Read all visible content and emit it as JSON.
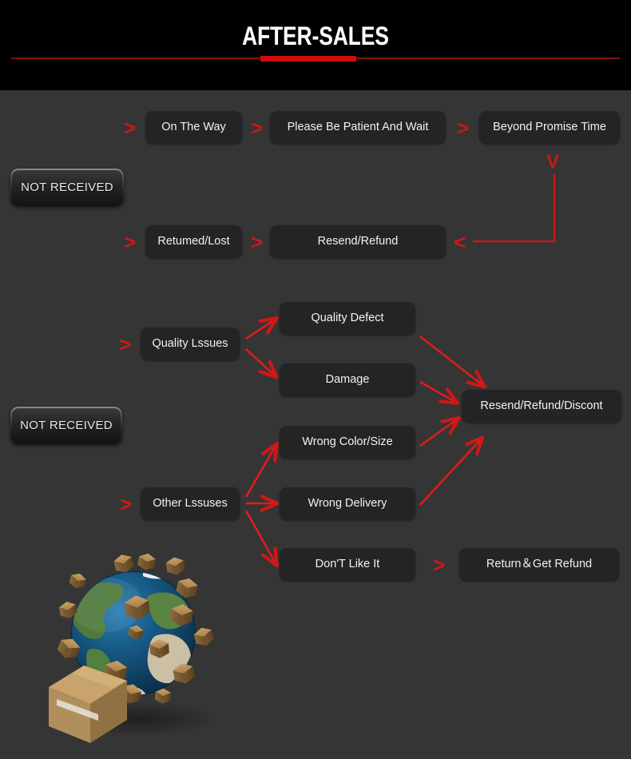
{
  "header": {
    "title": "AFTER-SALES",
    "rule_color": "#7e1414",
    "accent_color": "#cc0d0d"
  },
  "theme": {
    "background": "#353535",
    "header_background": "#000000",
    "box_background": "#242424",
    "box_text": "#f2f2f2",
    "arrow_color": "#cf1717"
  },
  "badges": [
    {
      "label": "NOT RECEIVED"
    },
    {
      "label": "NOT RECEIVED"
    }
  ],
  "flow": {
    "not_received_chain": {
      "row_top": [
        {
          "label": "On The Way"
        },
        {
          "label": "Please Be Patient And Wait"
        },
        {
          "label": "Beyond Promise Time"
        }
      ],
      "row_bottom": [
        {
          "label": "Retumed/Lost"
        },
        {
          "label": "Resend/Refund"
        }
      ]
    },
    "quality_issues": {
      "source": {
        "label": "Quality Lssues"
      },
      "branches": [
        {
          "label": "Quality Defect"
        },
        {
          "label": "Damage"
        }
      ]
    },
    "other_issues": {
      "source": {
        "label": "Other Lssuses"
      },
      "branches": [
        {
          "label": "Wrong Color/Size"
        },
        {
          "label": "Wrong Delivery"
        },
        {
          "label": "Don'T Like It"
        }
      ]
    },
    "outcomes": [
      {
        "label": "Resend/Refund/Discont"
      },
      {
        "label": "Return＆Get Refund"
      }
    ]
  },
  "icons": {
    "chevron_right": ">",
    "chevron_left": "<",
    "chevron_down": "V"
  },
  "artwork": {
    "name": "globe-with-parcels-illustration"
  }
}
